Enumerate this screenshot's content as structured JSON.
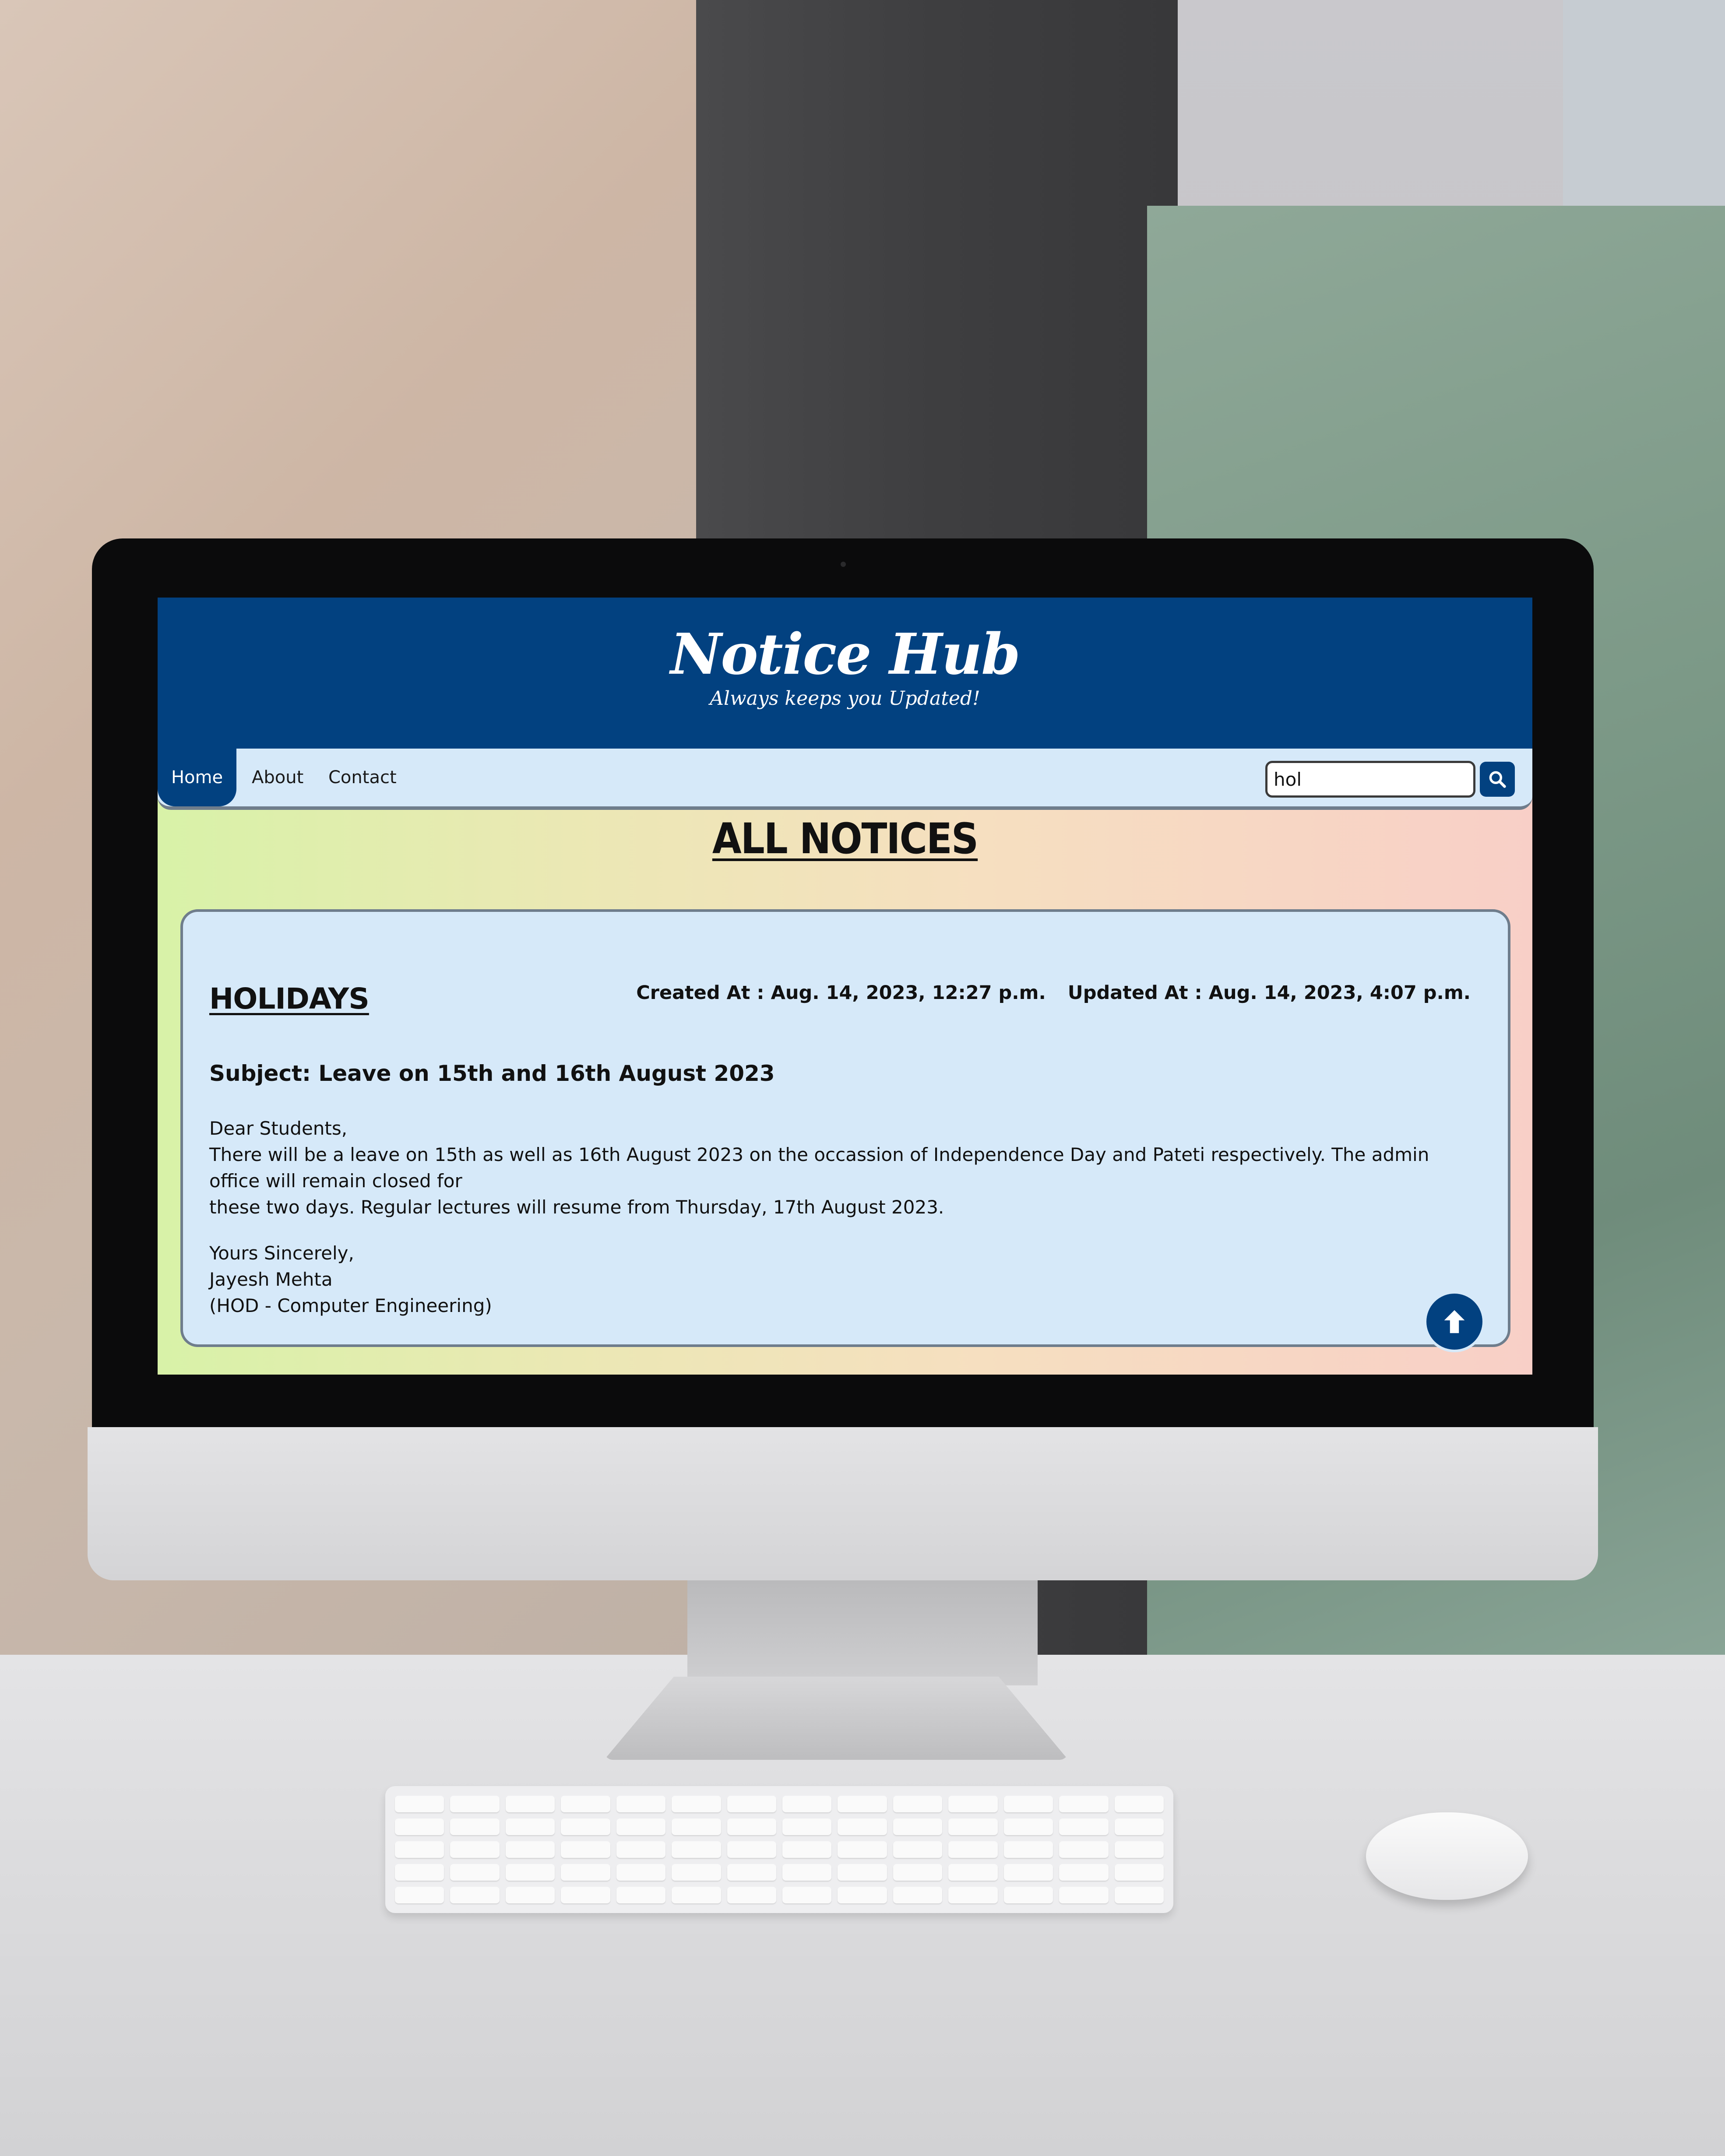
{
  "site": {
    "logo_title": "Notice Hub",
    "logo_tagline": "Always keeps you Updated!",
    "colors": {
      "header": "#024180",
      "card": "#d6e9f9"
    }
  },
  "nav": {
    "items": [
      {
        "label": "Home",
        "active": true
      },
      {
        "label": "About",
        "active": false
      },
      {
        "label": "Contact",
        "active": false
      }
    ]
  },
  "search": {
    "value": "hol",
    "button_icon": "search-icon"
  },
  "page": {
    "heading": "ALL NOTICES"
  },
  "notice": {
    "title": "HOLIDAYS",
    "created_label": "Created At : Aug. 14, 2023, 12:27 p.m.",
    "updated_label": "Updated At : Aug. 14, 2023, 4:07 p.m.",
    "subject": "Subject: Leave on 15th and 16th August 2023",
    "greeting": "Dear Students,",
    "body_line1": "There will be a leave on 15th as well as 16th August 2023 on the occassion of Independence Day and Pateti respectively. The admin office will remain closed for",
    "body_line2": "these two days. Regular lectures will resume from Thursday, 17th August 2023.",
    "closing": "Yours Sincerely,",
    "signer_name": "Jayesh Mehta",
    "signer_title": "(HOD - Computer Engineering)"
  },
  "scroll_top": {
    "icon": "arrow-up-icon"
  }
}
